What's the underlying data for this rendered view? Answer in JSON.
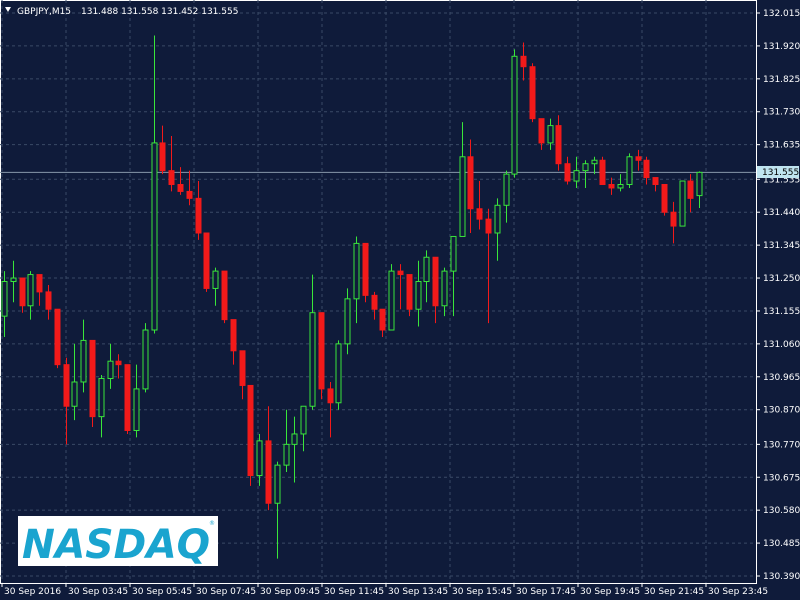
{
  "header": {
    "symbol": "GBPJPY,M15",
    "ohlc": "131.488 131.558 131.452 131.555"
  },
  "logo": {
    "text": "NASDAQ",
    "mark": "®"
  },
  "colors": {
    "background": "#0f1b3a",
    "grid": "#3a4a66",
    "axis": "#ffffff",
    "bull": "#39e63a",
    "bear": "#f21a1a",
    "price_tag": "#bfe4f0",
    "logo_blue": "#1aa4cf"
  },
  "chart_data": {
    "type": "candlestick",
    "title": "GBPJPY,M15",
    "current_price": "131.555",
    "ylim": [
      130.39,
      132.015
    ],
    "y_ticks": [
      "132.015",
      "131.920",
      "131.825",
      "131.730",
      "131.635",
      "131.535",
      "131.440",
      "131.345",
      "131.250",
      "131.155",
      "131.060",
      "130.965",
      "130.870",
      "130.770",
      "130.675",
      "130.580",
      "130.485",
      "130.390"
    ],
    "x_labels": [
      "30 Sep 2016",
      "30 Sep 03:45",
      "30 Sep 05:45",
      "30 Sep 07:45",
      "30 Sep 09:45",
      "30 Sep 11:45",
      "30 Sep 13:45",
      "30 Sep 15:45",
      "30 Sep 17:45",
      "30 Sep 19:45",
      "30 Sep 21:45",
      "30 Sep 23:45"
    ],
    "grid": true,
    "candles": [
      {
        "o": 131.14,
        "h": 131.27,
        "l": 131.08,
        "c": 131.24
      },
      {
        "o": 131.24,
        "h": 131.3,
        "l": 131.18,
        "c": 131.25
      },
      {
        "o": 131.25,
        "h": 131.25,
        "l": 131.15,
        "c": 131.17
      },
      {
        "o": 131.17,
        "h": 131.27,
        "l": 131.13,
        "c": 131.26
      },
      {
        "o": 131.26,
        "h": 131.26,
        "l": 131.17,
        "c": 131.21
      },
      {
        "o": 131.21,
        "h": 131.23,
        "l": 131.13,
        "c": 131.16
      },
      {
        "o": 131.16,
        "h": 131.16,
        "l": 130.99,
        "c": 131.0
      },
      {
        "o": 131.0,
        "h": 131.02,
        "l": 130.77,
        "c": 130.88
      },
      {
        "o": 130.88,
        "h": 131.06,
        "l": 130.84,
        "c": 130.95
      },
      {
        "o": 130.95,
        "h": 131.13,
        "l": 130.92,
        "c": 131.07
      },
      {
        "o": 131.07,
        "h": 131.07,
        "l": 130.82,
        "c": 130.85
      },
      {
        "o": 130.85,
        "h": 130.97,
        "l": 130.79,
        "c": 130.96
      },
      {
        "o": 130.96,
        "h": 131.06,
        "l": 130.93,
        "c": 131.01
      },
      {
        "o": 131.01,
        "h": 131.03,
        "l": 130.96,
        "c": 131.0
      },
      {
        "o": 131.0,
        "h": 131.0,
        "l": 130.8,
        "c": 130.81
      },
      {
        "o": 130.81,
        "h": 131.0,
        "l": 130.79,
        "c": 130.93
      },
      {
        "o": 130.93,
        "h": 131.12,
        "l": 130.92,
        "c": 131.1
      },
      {
        "o": 131.1,
        "h": 131.95,
        "l": 131.09,
        "c": 131.64
      },
      {
        "o": 131.64,
        "h": 131.69,
        "l": 131.55,
        "c": 131.56
      },
      {
        "o": 131.56,
        "h": 131.66,
        "l": 131.5,
        "c": 131.52
      },
      {
        "o": 131.52,
        "h": 131.57,
        "l": 131.49,
        "c": 131.5
      },
      {
        "o": 131.5,
        "h": 131.56,
        "l": 131.46,
        "c": 131.48
      },
      {
        "o": 131.48,
        "h": 131.53,
        "l": 131.36,
        "c": 131.38
      },
      {
        "o": 131.38,
        "h": 131.38,
        "l": 131.21,
        "c": 131.22
      },
      {
        "o": 131.22,
        "h": 131.28,
        "l": 131.17,
        "c": 131.27
      },
      {
        "o": 131.27,
        "h": 131.27,
        "l": 131.12,
        "c": 131.13
      },
      {
        "o": 131.13,
        "h": 131.13,
        "l": 131.0,
        "c": 131.04
      },
      {
        "o": 131.04,
        "h": 131.04,
        "l": 130.9,
        "c": 130.94
      },
      {
        "o": 130.94,
        "h": 130.94,
        "l": 130.65,
        "c": 130.68
      },
      {
        "o": 130.68,
        "h": 130.8,
        "l": 130.65,
        "c": 130.78
      },
      {
        "o": 130.78,
        "h": 130.88,
        "l": 130.58,
        "c": 130.6
      },
      {
        "o": 130.6,
        "h": 130.72,
        "l": 130.44,
        "c": 130.71
      },
      {
        "o": 130.71,
        "h": 130.87,
        "l": 130.69,
        "c": 130.77
      },
      {
        "o": 130.77,
        "h": 130.85,
        "l": 130.66,
        "c": 130.8
      },
      {
        "o": 130.8,
        "h": 130.88,
        "l": 130.75,
        "c": 130.88
      },
      {
        "o": 130.88,
        "h": 131.26,
        "l": 130.87,
        "c": 131.15
      },
      {
        "o": 131.15,
        "h": 131.15,
        "l": 130.9,
        "c": 130.93
      },
      {
        "o": 130.93,
        "h": 130.95,
        "l": 130.79,
        "c": 130.89
      },
      {
        "o": 130.89,
        "h": 131.07,
        "l": 130.87,
        "c": 131.06
      },
      {
        "o": 131.06,
        "h": 131.22,
        "l": 131.03,
        "c": 131.19
      },
      {
        "o": 131.19,
        "h": 131.37,
        "l": 131.12,
        "c": 131.35
      },
      {
        "o": 131.35,
        "h": 131.35,
        "l": 131.18,
        "c": 131.2
      },
      {
        "o": 131.2,
        "h": 131.21,
        "l": 131.13,
        "c": 131.16
      },
      {
        "o": 131.16,
        "h": 131.16,
        "l": 131.08,
        "c": 131.1
      },
      {
        "o": 131.1,
        "h": 131.29,
        "l": 131.1,
        "c": 131.27
      },
      {
        "o": 131.27,
        "h": 131.29,
        "l": 131.16,
        "c": 131.26
      },
      {
        "o": 131.26,
        "h": 131.26,
        "l": 131.14,
        "c": 131.16
      },
      {
        "o": 131.16,
        "h": 131.3,
        "l": 131.11,
        "c": 131.24
      },
      {
        "o": 131.24,
        "h": 131.33,
        "l": 131.18,
        "c": 131.31
      },
      {
        "o": 131.31,
        "h": 131.31,
        "l": 131.12,
        "c": 131.17
      },
      {
        "o": 131.17,
        "h": 131.28,
        "l": 131.14,
        "c": 131.27
      },
      {
        "o": 131.27,
        "h": 131.37,
        "l": 131.14,
        "c": 131.37
      },
      {
        "o": 131.37,
        "h": 131.7,
        "l": 131.38,
        "c": 131.6
      },
      {
        "o": 131.6,
        "h": 131.65,
        "l": 131.38,
        "c": 131.45
      },
      {
        "o": 131.45,
        "h": 131.53,
        "l": 131.39,
        "c": 131.42
      },
      {
        "o": 131.42,
        "h": 131.45,
        "l": 131.12,
        "c": 131.38
      },
      {
        "o": 131.38,
        "h": 131.48,
        "l": 131.3,
        "c": 131.46
      },
      {
        "o": 131.46,
        "h": 131.56,
        "l": 131.41,
        "c": 131.55
      },
      {
        "o": 131.55,
        "h": 131.91,
        "l": 131.54,
        "c": 131.89
      },
      {
        "o": 131.89,
        "h": 131.93,
        "l": 131.82,
        "c": 131.86
      },
      {
        "o": 131.86,
        "h": 131.87,
        "l": 131.7,
        "c": 131.71
      },
      {
        "o": 131.71,
        "h": 131.71,
        "l": 131.62,
        "c": 131.64
      },
      {
        "o": 131.64,
        "h": 131.71,
        "l": 131.62,
        "c": 131.69
      },
      {
        "o": 131.69,
        "h": 131.72,
        "l": 131.56,
        "c": 131.58
      },
      {
        "o": 131.58,
        "h": 131.6,
        "l": 131.52,
        "c": 131.53
      },
      {
        "o": 131.53,
        "h": 131.6,
        "l": 131.51,
        "c": 131.56
      },
      {
        "o": 131.56,
        "h": 131.59,
        "l": 131.51,
        "c": 131.58
      },
      {
        "o": 131.58,
        "h": 131.6,
        "l": 131.55,
        "c": 131.59
      },
      {
        "o": 131.59,
        "h": 131.6,
        "l": 131.52,
        "c": 131.52
      },
      {
        "o": 131.52,
        "h": 131.54,
        "l": 131.49,
        "c": 131.51
      },
      {
        "o": 131.51,
        "h": 131.55,
        "l": 131.5,
        "c": 131.52
      },
      {
        "o": 131.52,
        "h": 131.61,
        "l": 131.51,
        "c": 131.6
      },
      {
        "o": 131.6,
        "h": 131.62,
        "l": 131.56,
        "c": 131.59
      },
      {
        "o": 131.59,
        "h": 131.6,
        "l": 131.52,
        "c": 131.54
      },
      {
        "o": 131.54,
        "h": 131.54,
        "l": 131.5,
        "c": 131.52
      },
      {
        "o": 131.52,
        "h": 131.52,
        "l": 131.43,
        "c": 131.44
      },
      {
        "o": 131.44,
        "h": 131.47,
        "l": 131.35,
        "c": 131.4
      },
      {
        "o": 131.4,
        "h": 131.53,
        "l": 131.4,
        "c": 131.53
      },
      {
        "o": 131.53,
        "h": 131.55,
        "l": 131.44,
        "c": 131.48
      },
      {
        "o": 131.488,
        "h": 131.558,
        "l": 131.452,
        "c": 131.555
      }
    ]
  }
}
